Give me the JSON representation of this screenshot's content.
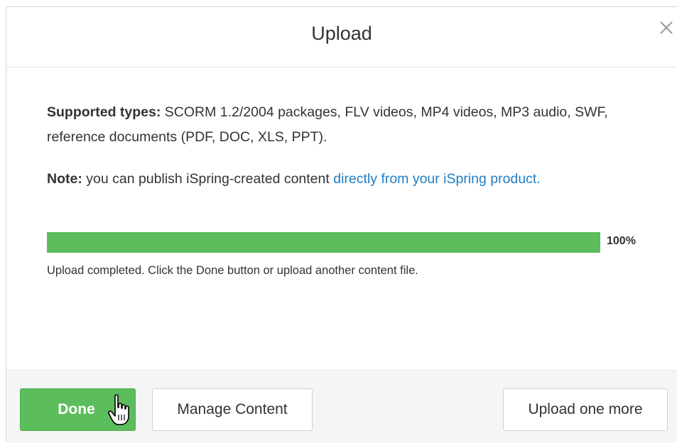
{
  "dialog": {
    "title": "Upload",
    "close_icon": "close-icon"
  },
  "content": {
    "supported_label": "Supported types:",
    "supported_text": " SCORM 1.2/2004 packages, FLV videos, MP4 videos, MP3 audio, SWF, reference documents (PDF, DOC, XLS, PPT).",
    "note_label": "Note:",
    "note_text": " you can publish iSpring-created content ",
    "note_link": "directly from your iSpring product",
    "note_end": "."
  },
  "progress": {
    "value": 1.0,
    "label": "100%",
    "fill_color": "#5cbd5c",
    "status": "Upload completed. Click the Done button or upload another content file."
  },
  "footer": {
    "done_label": "Done",
    "manage_label": "Manage Content",
    "upload_more_label": "Upload one more",
    "done_color": "#5cbd5c"
  },
  "cursor": {
    "icon": "hand-pointer-icon"
  }
}
